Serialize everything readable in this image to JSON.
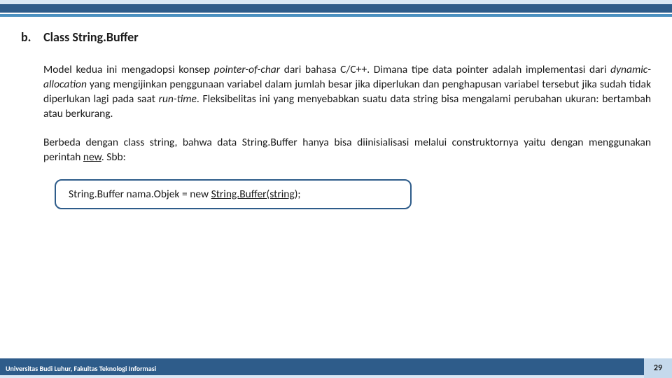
{
  "heading": {
    "num": "b.",
    "title": "Class String.Buffer"
  },
  "para1": {
    "t1": "Model kedua ini mengadopsi konsep ",
    "i1": "pointer-of-char",
    "t2": " dari bahasa C/C++. Dimana tipe data pointer adalah implementasi dari ",
    "i2": "dynamic-allocation",
    "t3": " yang mengijinkan penggunaan variabel dalam jumlah besar jika diperlukan dan penghapusan variabel tersebut jika sudah tidak diperlukan lagi pada saat ",
    "i3": "run-time",
    "t4": ". Fleksibelitas ini yang menyebabkan suatu data string bisa mengalami perubahan ukuran: bertambah atau berkurang."
  },
  "para2": {
    "t1": "Berbeda dengan class string, bahwa data String.Buffer hanya bisa diinisialisasi melalui construktornya yaitu dengan menggunakan perintah ",
    "u1": "new",
    "t2": ". Sbb:"
  },
  "code": {
    "t1": "String.Buffer nama.Objek = new ",
    "u1": "String.Buffer(string",
    "t2": ");"
  },
  "footer": {
    "org": "Universitas Budi Luhur, Fakultas Teknologi Informasi",
    "page": "29"
  }
}
